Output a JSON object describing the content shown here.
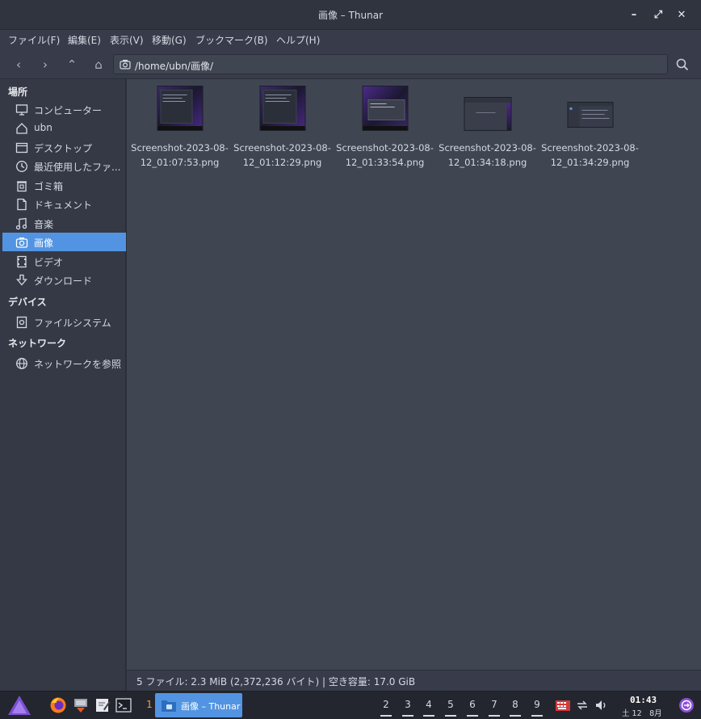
{
  "window": {
    "title": "画像 – Thunar",
    "minimize": "–",
    "maximize": "⤢",
    "close": "✕"
  },
  "menu": [
    "ファイル(F)",
    "編集(E)",
    "表示(V)",
    "移動(G)",
    "ブックマーク(B)",
    "ヘルプ(H)"
  ],
  "toolbar": {
    "back": "‹",
    "forward": "›",
    "up": "⌃",
    "home": "⌂",
    "path": "/home/ubn/画像/"
  },
  "sidebar": {
    "places_title": "場所",
    "places": [
      {
        "label": "コンピューター",
        "icon": "computer-icon"
      },
      {
        "label": "ubn",
        "icon": "home-icon"
      },
      {
        "label": "デスクトップ",
        "icon": "desktop-icon"
      },
      {
        "label": "最近使用したファ...",
        "icon": "recent-icon"
      },
      {
        "label": "ゴミ箱",
        "icon": "trash-icon"
      },
      {
        "label": "ドキュメント",
        "icon": "document-icon"
      },
      {
        "label": "音楽",
        "icon": "music-icon"
      },
      {
        "label": "画像",
        "icon": "camera-icon",
        "active": true
      },
      {
        "label": "ビデオ",
        "icon": "video-icon"
      },
      {
        "label": "ダウンロード",
        "icon": "download-icon"
      }
    ],
    "devices_title": "デバイス",
    "devices": [
      {
        "label": "ファイルシステム",
        "icon": "drive-icon"
      }
    ],
    "network_title": "ネットワーク",
    "network": [
      {
        "label": "ネットワークを参照",
        "icon": "network-icon"
      }
    ]
  },
  "files": [
    {
      "line1": "Screenshot-2023-08-",
      "line2": "12_01:07:53.png"
    },
    {
      "line1": "Screenshot-2023-08-",
      "line2": "12_01:12:29.png"
    },
    {
      "line1": "Screenshot-2023-08-",
      "line2": "12_01:33:54.png"
    },
    {
      "line1": "Screenshot-2023-08-",
      "line2": "12_01:34:18.png"
    },
    {
      "line1": "Screenshot-2023-08-",
      "line2": "12_01:34:29.png"
    }
  ],
  "status": "5 ファイル: 2.3 MiB (2,372,236 バイト) | 空き容量: 17.0 GiB",
  "taskbar": {
    "workspace_active": "1",
    "task_label": "画像 – Thunar",
    "workspaces": [
      "2",
      "3",
      "4",
      "5",
      "6",
      "7",
      "8",
      "9"
    ],
    "clock_time": "01:43",
    "clock_date": "土 12　8月"
  },
  "colors": {
    "accent": "#5294e2",
    "background": "#404552",
    "sidebar": "#353945",
    "titlebar": "#2f343f"
  }
}
